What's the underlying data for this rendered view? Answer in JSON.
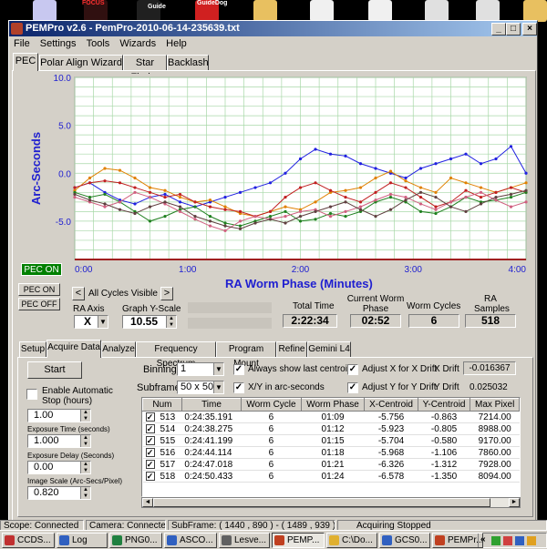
{
  "desktop": {
    "labels": [
      "FOCUS",
      "Guide",
      "GuideDog"
    ]
  },
  "window": {
    "title": "PEMPro v2.6 - PemPro-2010-06-14-235639.txt",
    "controls": [
      "_",
      "□",
      "×"
    ]
  },
  "menu": [
    "File",
    "Settings",
    "Tools",
    "Wizards",
    "Help"
  ],
  "main_tabs": [
    "PEC",
    "Polar Align Wizard",
    "Star Finder",
    "Backlash"
  ],
  "pec_status": {
    "on_badge": "PEC ON",
    "pec_on_btn": "PEC ON",
    "pec_off_btn": "PEC OFF"
  },
  "chart_data": {
    "type": "line",
    "ylabel": "Arc-Seconds",
    "xlabel": "RA Worm Phase (Minutes)",
    "y_ticks": [
      "10.0",
      "5.0",
      "0.0",
      "-5.0"
    ],
    "x_ticks": [
      "0:00",
      "1:00",
      "2:00",
      "3:00",
      "4:00"
    ],
    "ylim": [
      -9,
      10
    ],
    "xlim": [
      0,
      4
    ],
    "grid": true,
    "series": [
      {
        "color": "#2020e0",
        "values": [
          -1.5,
          -1.0,
          -2.0,
          -2.8,
          -3.2,
          -2.5,
          -2.2,
          -3.0,
          -3.5,
          -3.0,
          -2.5,
          -2.0,
          -1.5,
          -1.0,
          0.0,
          1.5,
          2.5,
          2.0,
          1.8,
          1.0,
          0.5,
          0.0,
          -0.5,
          0.5,
          1.0,
          1.5,
          2.0,
          1.0,
          1.5,
          2.8,
          0.0
        ]
      },
      {
        "color": "#e08000",
        "values": [
          -1.8,
          -0.5,
          0.5,
          0.3,
          -0.5,
          -1.5,
          -1.8,
          -2.5,
          -3.0,
          -2.8,
          -3.5,
          -4.2,
          -4.5,
          -4.0,
          -3.5,
          -3.8,
          -3.0,
          -2.0,
          -1.8,
          -1.5,
          -0.5,
          0.2,
          -0.8,
          -1.5,
          -2.0,
          -0.5,
          -1.0,
          -1.5,
          -2.0,
          -1.5,
          -1.0
        ]
      },
      {
        "color": "#c02020",
        "values": [
          -1.5,
          -1.0,
          -0.8,
          -1.0,
          -1.5,
          -2.0,
          -2.5,
          -2.2,
          -3.0,
          -3.5,
          -3.8,
          -4.0,
          -4.5,
          -4.0,
          -2.5,
          -1.5,
          -1.0,
          -1.8,
          -2.5,
          -3.0,
          -2.0,
          -1.0,
          -1.5,
          -2.5,
          -3.5,
          -3.0,
          -1.8,
          -2.5,
          -2.0,
          -1.5,
          -2.0
        ]
      },
      {
        "color": "#208020",
        "values": [
          -2.0,
          -2.5,
          -2.2,
          -3.0,
          -4.0,
          -5.0,
          -4.5,
          -3.8,
          -3.5,
          -4.5,
          -5.2,
          -5.5,
          -5.0,
          -4.5,
          -4.0,
          -5.0,
          -4.8,
          -4.2,
          -4.5,
          -4.0,
          -3.0,
          -2.5,
          -3.0,
          -4.0,
          -4.2,
          -3.5,
          -2.5,
          -3.0,
          -2.8,
          -2.5,
          -2.0
        ]
      },
      {
        "color": "#d06080",
        "values": [
          -2.5,
          -3.0,
          -3.5,
          -3.0,
          -2.0,
          -2.5,
          -3.2,
          -4.0,
          -4.8,
          -5.5,
          -6.0,
          -5.0,
          -4.5,
          -4.8,
          -4.5,
          -4.0,
          -3.8,
          -4.5,
          -4.0,
          -3.5,
          -2.8,
          -2.2,
          -2.5,
          -3.2,
          -3.8,
          -3.0,
          -2.5,
          -2.0,
          -2.8,
          -3.5,
          -3.0
        ]
      },
      {
        "color": "#604040",
        "values": [
          -2.2,
          -2.8,
          -3.2,
          -3.8,
          -4.2,
          -3.5,
          -3.0,
          -3.5,
          -4.5,
          -5.0,
          -5.5,
          -5.8,
          -5.2,
          -4.8,
          -5.2,
          -4.5,
          -4.0,
          -3.5,
          -3.0,
          -3.8,
          -4.5,
          -3.8,
          -2.8,
          -2.0,
          -2.5,
          -3.5,
          -4.0,
          -3.2,
          -2.5,
          -2.2,
          -1.8
        ]
      }
    ]
  },
  "controls": {
    "cycles_label": "All Cycles Visible",
    "prev": "<",
    "next": ">",
    "ra_axis_label": "RA Axis",
    "ra_axis_value": "X",
    "graph_yscale_label": "Graph Y-Scale",
    "graph_yscale_value": "10.55",
    "total_time_label": "Total Time",
    "total_time_value": "2:22:34",
    "current_worm_label": "Current Worm Phase",
    "current_worm_value": "02:52",
    "worm_cycles_label": "Worm Cycles",
    "worm_cycles_value": "6",
    "ra_samples_label": "RA Samples",
    "ra_samples_value": "518"
  },
  "sub_tabs": [
    "Setup",
    "Acquire Data",
    "Analyze",
    "Frequency Spectrum",
    "Program Mount",
    "Refine",
    "Gemini L4"
  ],
  "acquire": {
    "start_button": "Start",
    "auto_stop_label": "Enable Automatic Stop (hours)",
    "auto_stop_value": "1.00",
    "exposure_label": "Exposure Time (seconds)",
    "exposure_value": "1.000",
    "delay_label": "Exposure Delay (Seconds)",
    "delay_value": "0.00",
    "scale_label": "Image Scale (Arc-Secs/Pixel)",
    "scale_value": "0.820",
    "binning_label": "Binning",
    "binning_value": "1",
    "subframe_label": "Subframe",
    "subframe_value": "50 x 50",
    "always_show_label": "Always show last centroid",
    "xy_arcsec_label": "X/Y in arc-seconds",
    "adjust_x_label": "Adjust X for X Drift",
    "adjust_y_label": "Adjust Y for Y Drift",
    "x_drift_label": "X Drift",
    "x_drift_value": "-0.016367",
    "y_drift_label": "Y Drift",
    "y_drift_value": "0.025032"
  },
  "table": {
    "headers": [
      "Num",
      "Time",
      "Worm Cycle",
      "Worm Phase",
      "X-Centroid",
      "Y-Centroid",
      "Max Pixel"
    ],
    "rows": [
      [
        "513",
        "0:24:35.191",
        "6",
        "01:09",
        "-5.756",
        "-0.863",
        "7214.00"
      ],
      [
        "514",
        "0:24:38.275",
        "6",
        "01:12",
        "-5.923",
        "-0.805",
        "8988.00"
      ],
      [
        "515",
        "0:24:41.199",
        "6",
        "01:15",
        "-5.704",
        "-0.580",
        "9170.00"
      ],
      [
        "516",
        "0:24:44.114",
        "6",
        "01:18",
        "-5.968",
        "-1.106",
        "7860.00"
      ],
      [
        "517",
        "0:24:47.018",
        "6",
        "01:21",
        "-6.326",
        "-1.312",
        "7928.00"
      ],
      [
        "518",
        "0:24:50.433",
        "6",
        "01:24",
        "-6.578",
        "-1.350",
        "8094.00"
      ]
    ]
  },
  "statusbar": [
    "Scope: Connected",
    "Camera: Connected",
    "SubFrame: ( 1440 , 890 ) - ( 1489 , 939 )",
    "Acquiring Stopped"
  ],
  "taskbar": [
    {
      "label": "CCDS...",
      "color": "#c03030"
    },
    {
      "label": "Log",
      "color": "#3060c0"
    },
    {
      "label": "PNG0...",
      "color": "#208040"
    },
    {
      "label": "ASCO...",
      "color": "#3060c0"
    },
    {
      "label": "Lesve...",
      "color": "#606060"
    },
    {
      "label": "PEMP...",
      "color": "#c04020"
    },
    {
      "label": "C:\\Do...",
      "color": "#e0b030"
    },
    {
      "label": "GCS0...",
      "color": "#3060c0"
    },
    {
      "label": "PEMPr...",
      "color": "#c04020"
    }
  ]
}
